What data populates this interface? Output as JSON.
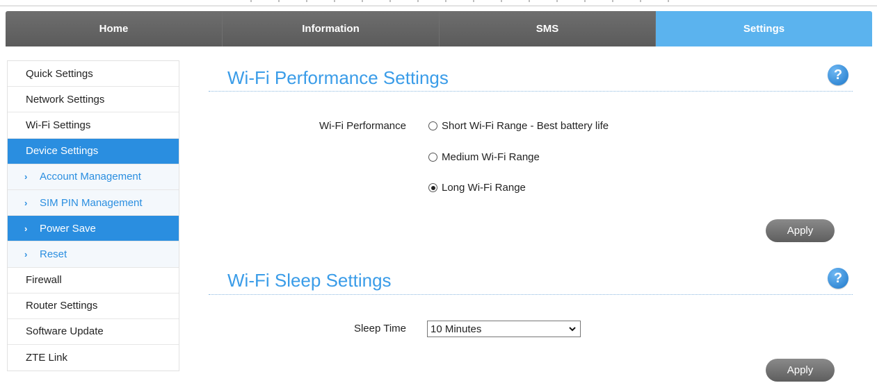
{
  "nav": {
    "tabs": [
      {
        "label": "Home"
      },
      {
        "label": "Information"
      },
      {
        "label": "SMS"
      },
      {
        "label": "Settings"
      }
    ],
    "active": "Settings"
  },
  "sidebar": {
    "items": [
      {
        "label": "Quick Settings"
      },
      {
        "label": "Network Settings"
      },
      {
        "label": "Wi-Fi Settings"
      },
      {
        "label": "Device Settings"
      },
      {
        "label": "Account Management"
      },
      {
        "label": "SIM PIN Management"
      },
      {
        "label": "Power Save"
      },
      {
        "label": "Reset"
      },
      {
        "label": "Firewall"
      },
      {
        "label": "Router Settings"
      },
      {
        "label": "Software Update"
      },
      {
        "label": "ZTE Link"
      }
    ]
  },
  "performance": {
    "title": "Wi-Fi Performance Settings",
    "field_label": "Wi-Fi Performance",
    "options": [
      {
        "label": "Short Wi-Fi Range - Best battery life",
        "checked": false
      },
      {
        "label": "Medium Wi-Fi Range",
        "checked": false
      },
      {
        "label": "Long Wi-Fi Range",
        "checked": true
      }
    ],
    "apply_label": "Apply",
    "help_label": "?"
  },
  "sleep": {
    "title": "Wi-Fi Sleep Settings",
    "field_label": "Sleep Time",
    "selected": "10 Minutes",
    "apply_label": "Apply",
    "help_label": "?"
  },
  "colors": {
    "accent": "#5bb3ee",
    "sidebar_active": "#2a8ee0",
    "title": "#3a9ce8",
    "nav_bg": "#616161"
  },
  "icons": [
    "help-icon",
    "chevron-right-icon",
    "dropdown-caret-icon"
  ]
}
